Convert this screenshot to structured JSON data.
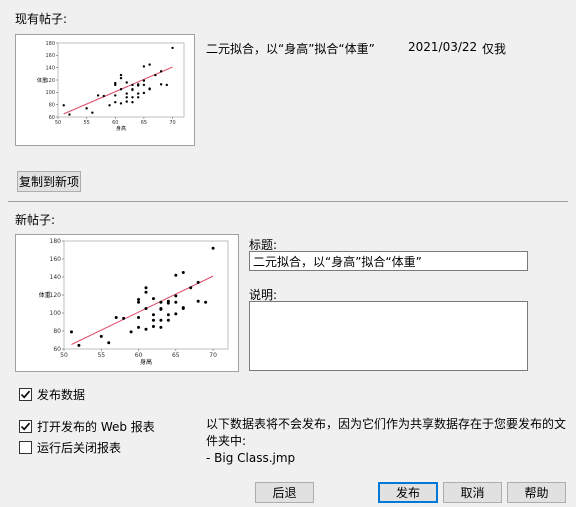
{
  "existing": {
    "header": "现有帖子:",
    "title": "二元拟合，以“身高”拟合“体重”",
    "date": "2021/03/22",
    "visibility": "仅我",
    "copy_button": "复制到新项"
  },
  "new_post": {
    "header": "新帖子:",
    "title_label": "标题:",
    "title_value": "二元拟合，以“身高”拟合“体重”",
    "description_label": "说明:",
    "description_value": ""
  },
  "options": {
    "publish_data": {
      "label": "发布数据",
      "checked": true
    },
    "open_web_report": {
      "label": "打开发布的 Web 报表",
      "checked": true
    },
    "close_after_run": {
      "label": "运行后关闭报表",
      "checked": false
    }
  },
  "notice": {
    "text": "以下数据表将不会发布，因为它们作为共享数据存在于您要发布的文件夹中:",
    "file": "- Big Class.jmp"
  },
  "buttons": {
    "back": "后退",
    "publish": "发布",
    "cancel": "取消",
    "help": "帮助"
  },
  "chart_data": {
    "type": "scatter",
    "xlabel": "身高",
    "ylabel": "体重",
    "xlim": [
      50,
      72
    ],
    "ylim": [
      60,
      180
    ],
    "x_ticks": [
      50,
      55,
      60,
      65,
      70
    ],
    "y_ticks": [
      60,
      80,
      100,
      120,
      140,
      160,
      180
    ],
    "points": [
      [
        51,
        79
      ],
      [
        52,
        64
      ],
      [
        55,
        74
      ],
      [
        56,
        67
      ],
      [
        57,
        95
      ],
      [
        58,
        94
      ],
      [
        59,
        79
      ],
      [
        60,
        84
      ],
      [
        60,
        112
      ],
      [
        60,
        115
      ],
      [
        60,
        95
      ],
      [
        61,
        82
      ],
      [
        61,
        105
      ],
      [
        61,
        128
      ],
      [
        61,
        123
      ],
      [
        62,
        85
      ],
      [
        62,
        92
      ],
      [
        62,
        116
      ],
      [
        62,
        98
      ],
      [
        63,
        84
      ],
      [
        63,
        112
      ],
      [
        63,
        104
      ],
      [
        63,
        92
      ],
      [
        63,
        105
      ],
      [
        64,
        98
      ],
      [
        64,
        111
      ],
      [
        64,
        113
      ],
      [
        64,
        92
      ],
      [
        65,
        142
      ],
      [
        65,
        119
      ],
      [
        65,
        112
      ],
      [
        65,
        99
      ],
      [
        66,
        105
      ],
      [
        66,
        145
      ],
      [
        66,
        106
      ],
      [
        67,
        128
      ],
      [
        68,
        113
      ],
      [
        68,
        134
      ],
      [
        69,
        112
      ],
      [
        70,
        172
      ]
    ],
    "fit_line": {
      "x": [
        51,
        70
      ],
      "y": [
        65,
        141
      ],
      "color": "#e0506c"
    },
    "point_color": "#000000"
  }
}
